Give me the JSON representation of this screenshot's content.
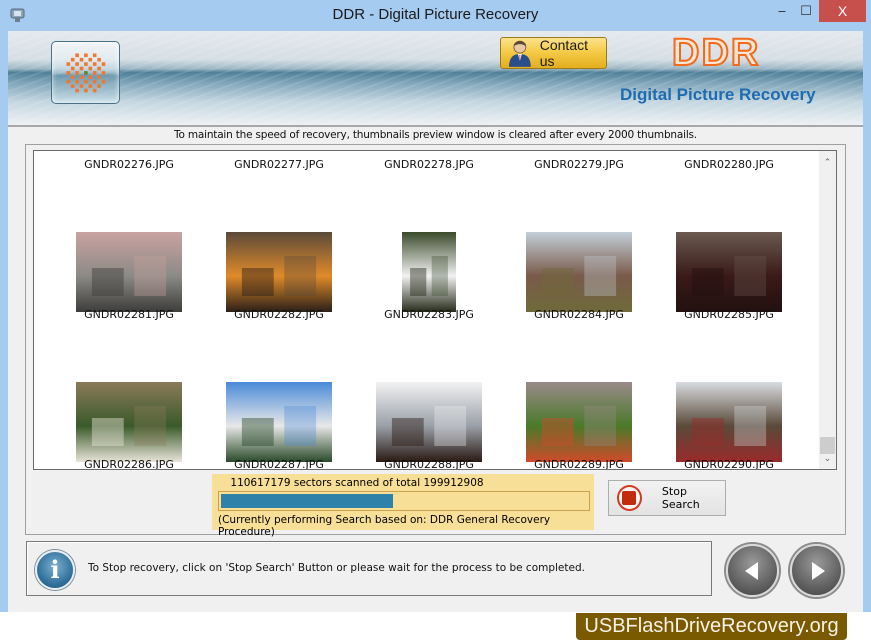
{
  "window": {
    "title": "DDR - Digital Picture Recovery",
    "minimize": "‒",
    "maximize": "☐",
    "close": "X"
  },
  "banner": {
    "contact_label": "Contact us",
    "brand": "DDR",
    "subtitle": "Digital Picture Recovery"
  },
  "notice": "To maintain the speed of recovery, thumbnails preview window is cleared after every 2000 thumbnails.",
  "thumbnails": [
    {
      "name": "GNDR02276.JPG",
      "row": 0,
      "col": 0,
      "image": false
    },
    {
      "name": "GNDR02277.JPG",
      "row": 0,
      "col": 1,
      "image": false
    },
    {
      "name": "GNDR02278.JPG",
      "row": 0,
      "col": 2,
      "image": false
    },
    {
      "name": "GNDR02279.JPG",
      "row": 0,
      "col": 3,
      "image": false
    },
    {
      "name": "GNDR02280.JPG",
      "row": 0,
      "col": 4,
      "image": false
    },
    {
      "name": "GNDR02281.JPG",
      "row": 1,
      "col": 0,
      "image": true,
      "subject": "hotel-building",
      "colors": [
        "#c9a3a0",
        "#8c8a86",
        "#3c3c3a"
      ]
    },
    {
      "name": "GNDR02282.JPG",
      "row": 1,
      "col": 1,
      "image": true,
      "subject": "sunset-sea",
      "colors": [
        "#5a4a3a",
        "#e08a2a",
        "#2a2018"
      ]
    },
    {
      "name": "GNDR02283.JPG",
      "row": 1,
      "col": 2,
      "image": true,
      "subject": "chef-portrait",
      "colors": [
        "#3a4a2a",
        "#f2f2f2",
        "#262b1a"
      ],
      "portrait": true
    },
    {
      "name": "GNDR02284.JPG",
      "row": 1,
      "col": 3,
      "image": true,
      "subject": "valley-landscape",
      "colors": [
        "#c3cfd8",
        "#7a5a4a",
        "#6f6a3a"
      ]
    },
    {
      "name": "GNDR02285.JPG",
      "row": 1,
      "col": 4,
      "image": true,
      "subject": "restaurant-interior",
      "colors": [
        "#6a5a50",
        "#3a1a18",
        "#221010"
      ]
    },
    {
      "name": "GNDR02286.JPG",
      "row": 2,
      "col": 0,
      "image": true,
      "subject": "garden-patio",
      "colors": [
        "#8a7a5a",
        "#3a5a2a",
        "#e8e4d8"
      ]
    },
    {
      "name": "GNDR02287.JPG",
      "row": 2,
      "col": 1,
      "image": true,
      "subject": "resort-building",
      "colors": [
        "#4a8ad8",
        "#e8e8e8",
        "#2a4a2a"
      ]
    },
    {
      "name": "GNDR02288.JPG",
      "row": 2,
      "col": 2,
      "image": true,
      "subject": "marina-bay-person",
      "colors": [
        "#f2f2f2",
        "#9aa0a8",
        "#2a1a14"
      ]
    },
    {
      "name": "GNDR02289.JPG",
      "row": 2,
      "col": 3,
      "image": true,
      "subject": "tropical-garden",
      "colors": [
        "#9a8a8a",
        "#4a7a2a",
        "#d04a2a"
      ]
    },
    {
      "name": "GNDR02290.JPG",
      "row": 2,
      "col": 4,
      "image": true,
      "subject": "cable-car-snow",
      "colors": [
        "#d8dce0",
        "#5a4a3a",
        "#9a2a2a"
      ]
    }
  ],
  "scrollbar": {
    "up_icon": "chevron-up",
    "down_icon": "chevron-down",
    "up_glyph": "⌃",
    "down_glyph": "⌄",
    "position": 0.93
  },
  "progress": {
    "scanned_text": "110617179 sectors scanned of total 199912908",
    "sectors_scanned": 110617179,
    "sectors_total": 199912908,
    "bar_fill_fraction": 0.47,
    "status_text": "(Currently performing Search based on:  DDR General Recovery Procedure)"
  },
  "stop_button": {
    "label": "Stop Search"
  },
  "info": {
    "icon_glyph": "i",
    "text": "To Stop recovery, click on 'Stop Search' Button or please wait for the process to be completed."
  },
  "nav": {
    "prev_icon": "back-arrow",
    "next_icon": "forward-arrow"
  },
  "watermark": "USBFlashDriveRecovery.org",
  "colors": {
    "titlebar": "#a6cbf1",
    "close": "#c7504d",
    "progress_bg": "#f8df98",
    "progress_fill": "#2e81a8",
    "brand_orange": "#f26a1b",
    "subtitle_blue": "#1e6bb0",
    "watermark_bg": "#7a5a00"
  }
}
